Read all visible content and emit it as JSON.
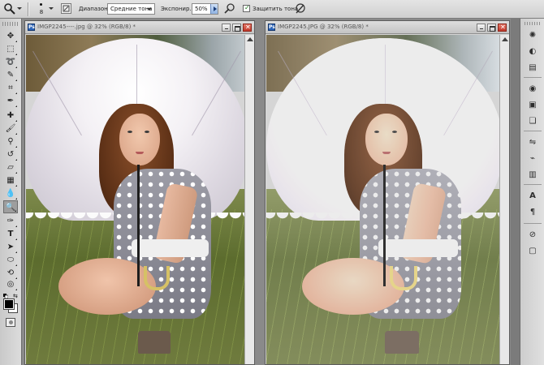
{
  "options_bar": {
    "brush_size": "8",
    "range_label": "Диапазон:",
    "range_value": "Средние тона",
    "exposure_label": "Экспонир.:",
    "exposure_value": "50%",
    "protect_tones_label": "Защитить тона",
    "protect_tones_checked": true
  },
  "documents": [
    {
      "title": "IMGP2245----.jpg @ 32% (RGB/8) *"
    },
    {
      "title": "IMGP2245.JPG @ 32% (RGB/8) *"
    }
  ],
  "toolbox": {
    "tools": [
      "move-tool",
      "marquee-tool",
      "lasso-tool",
      "quick-selection-tool",
      "crop-tool",
      "eyedropper-tool",
      "spot-healing-tool",
      "brush-tool",
      "clone-stamp-tool",
      "history-brush-tool",
      "eraser-tool",
      "gradient-tool",
      "blur-tool",
      "dodge-tool",
      "pen-tool",
      "type-tool",
      "path-selection-tool",
      "shape-tool",
      "3d-rotate-tool",
      "3d-orbit-tool",
      "hand-tool",
      "zoom-tool"
    ],
    "active_tool": "dodge-tool",
    "foreground_color": "#000000",
    "background_color": "#ffffff"
  },
  "dock": {
    "icons": [
      "color-icon",
      "swatches-icon",
      "styles-icon",
      "adjustments-icon",
      "masks-icon",
      "layers-icon",
      "channels-icon",
      "paths-icon",
      "character-icon",
      "paragraph-icon",
      "navigator-icon",
      "info-icon"
    ]
  }
}
